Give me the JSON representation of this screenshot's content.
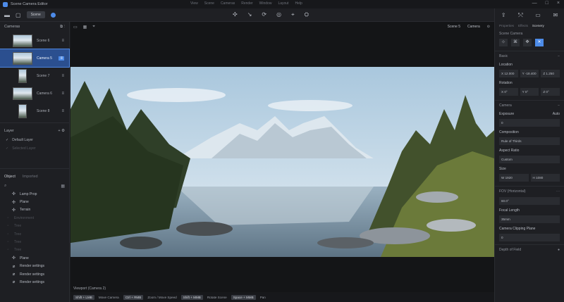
{
  "app": {
    "title": "Scene Camera Editor"
  },
  "top_menu": [
    "View",
    "Scene",
    "Cameras",
    "Render",
    "Window",
    "Layout",
    "Help"
  ],
  "window_controls": [
    "—",
    "□",
    "×"
  ],
  "toolbar": {
    "scene_label": "Scene",
    "left_icons": [
      "sidebar-icon",
      "document-icon"
    ],
    "tools": [
      "✣",
      "↘",
      "⟳",
      "◎",
      "⌖",
      "⛭"
    ],
    "right_icons": [
      "export-icon",
      "share-icon",
      "folder-icon",
      "mail-icon"
    ]
  },
  "left_panel": {
    "cameras_title": "Cameras",
    "cameras": [
      {
        "label": "Scene 6",
        "selected": false,
        "thumb": "h"
      },
      {
        "label": "Camera 5",
        "selected": true,
        "thumb": "h"
      },
      {
        "label": "Scene 7",
        "selected": false,
        "thumb": "v"
      },
      {
        "label": "Camera 6",
        "selected": false,
        "thumb": "h"
      },
      {
        "label": "Scene 8",
        "selected": false,
        "thumb": "v"
      }
    ],
    "layers_title": "Layer",
    "layers": [
      {
        "label": "Default Layer",
        "dim": false
      },
      {
        "label": "Selected Layer",
        "dim": true
      }
    ],
    "tabs": [
      "Object",
      "Imported"
    ],
    "objects": [
      {
        "icon": "✣",
        "label": "Lamp Prop",
        "dim": false
      },
      {
        "icon": "✣",
        "label": "Plane",
        "dim": false
      },
      {
        "icon": "✣",
        "label": "Terrain",
        "dim": false
      },
      {
        "icon": "◦",
        "label": "Environment",
        "dim": true
      },
      {
        "icon": "◦",
        "label": "Tree",
        "dim": true
      },
      {
        "icon": "◦",
        "label": "Tree",
        "dim": true
      },
      {
        "icon": "◦",
        "label": "Tree",
        "dim": true
      },
      {
        "icon": "◦",
        "label": "Tree",
        "dim": true
      },
      {
        "icon": "✣",
        "label": "Plane",
        "dim": false
      },
      {
        "icon": "⌀",
        "label": "Render settings",
        "dim": false
      },
      {
        "icon": "⌀",
        "label": "Render settings",
        "dim": false
      },
      {
        "icon": "⌀",
        "label": "Render settings",
        "dim": false
      }
    ]
  },
  "viewport": {
    "top_left": [
      "▭",
      "▦",
      "⌖"
    ],
    "top_right": [
      "Scene 5",
      "Camera",
      "⊙"
    ],
    "caption": "Viewport (Camera 2)"
  },
  "statusbar": [
    {
      "key": "Shift + LMB",
      "text": "Move Camera"
    },
    {
      "key": "Ctrl + RMB",
      "text": "Zoom / Move Speed"
    },
    {
      "key": "Shift + MMB",
      "text": "Rotate Scene"
    },
    {
      "key": "Space + MMB",
      "text": "Pan"
    }
  ],
  "right_panel": {
    "icons": [
      "export-icon",
      "share-icon",
      "folder-icon",
      "mail-icon"
    ],
    "tabs": [
      "Properties",
      "Effects",
      "Scenery"
    ],
    "scene_camera_label": "Scene Camera",
    "transform_title": "Basic",
    "location_label": "Location",
    "location": [
      "X 12.000",
      "Y -18.400",
      "Z 1.250"
    ],
    "rotation_label": "Rotation",
    "rotation": [
      "X 0°",
      "Y 0°",
      "Z 0°"
    ],
    "camera_title": "Camera",
    "exposure_label": "Exposure",
    "exposure_value": "Auto",
    "exposure_field": "0",
    "composition_label": "Composition",
    "composition_value": "Rule of Thirds",
    "aspect_label": "Aspect Ratio",
    "aspect_value": "Custom",
    "size_label": "Size",
    "size_values": [
      "W 1920",
      "H 1080"
    ],
    "fov_label": "FOV (Horizontal)",
    "fov_value": "60.0°",
    "focal_label": "Focal Length",
    "focal_value": "35mm",
    "clip_label": "Camera Clipping Plane",
    "clip_value": "0",
    "bottom_label": "Depth of Field"
  }
}
